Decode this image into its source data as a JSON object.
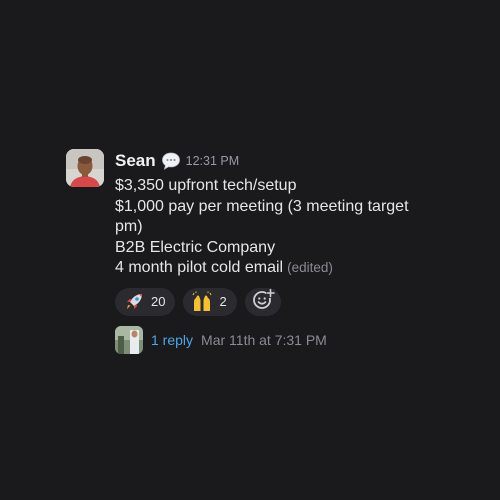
{
  "message": {
    "username": "Sean",
    "status_icon": "speech-bubble-icon",
    "timestamp": "12:31 PM",
    "lines": [
      "$3,350 upfront tech/setup",
      "$1,000 pay per meeting (3 meeting target",
      "pm)",
      "B2B Electric Company",
      "4 month pilot cold email"
    ],
    "edited_label": "(edited)"
  },
  "reactions": [
    {
      "emoji": "rocket-icon",
      "count": "20"
    },
    {
      "emoji": "raised-hands-icon",
      "count": "2"
    }
  ],
  "add_reaction_icon": "add-emoji-icon",
  "thread": {
    "reply_count": "1 reply",
    "last_reply_time": "Mar 11th at 7:31 PM"
  },
  "colors": {
    "background": "#1a1a1d",
    "link": "#4ea6e6",
    "reaction_bg": "#2b2b2f",
    "muted_text": "#8c8c90"
  }
}
